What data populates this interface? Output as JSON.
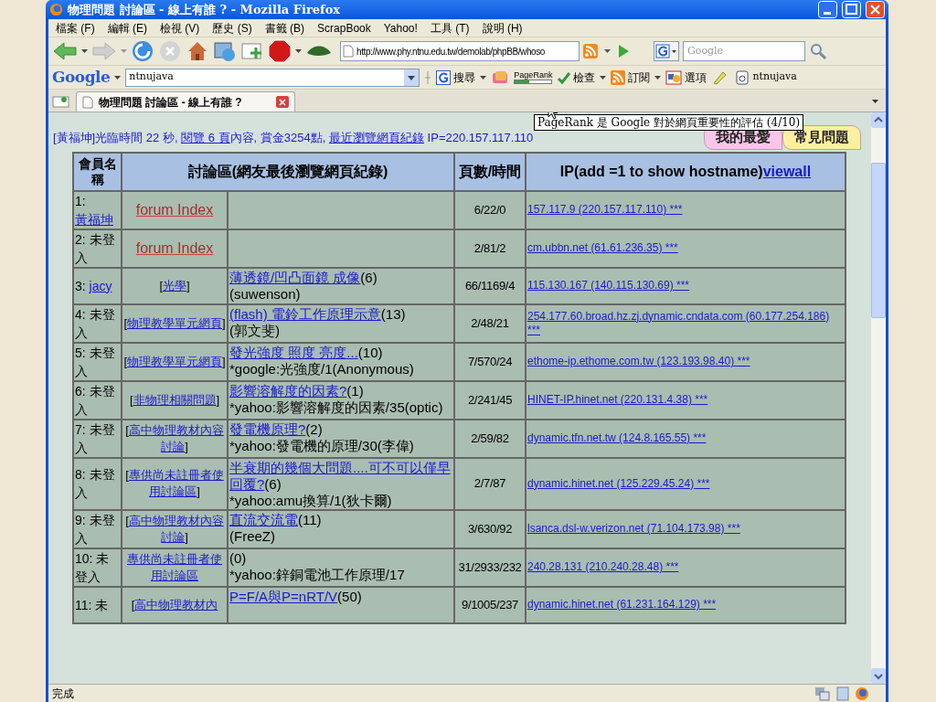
{
  "window": {
    "title": "物理問題 討論區 - 線上有誰 ? - Mozilla Firefox"
  },
  "menu": [
    "檔案 (F)",
    "編輯 (E)",
    "檢視 (V)",
    "歷史 (S)",
    "書籤 (B)",
    "ScrapBook",
    "Yahoo!",
    "工具 (T)",
    "說明 (H)"
  ],
  "navigation": {
    "url": "http://www.phy.ntnu.edu.tw/demolab/phpBB/whoso",
    "search_placeholder": "Google"
  },
  "google_toolbar": {
    "logo": "Google",
    "query": "ntnujava",
    "search": "搜尋",
    "pagerank": {
      "label": "PageRank",
      "level": 0.4
    },
    "check": "檢查",
    "subscribe": "訂閱",
    "options": "選項",
    "account": "ntnujava"
  },
  "tabs": [
    {
      "title": "物理問題 討論區 - 線上有誰 ?",
      "selected": true
    }
  ],
  "tooltip": "PageRank 是 Google 對於網頁重要性的評估 (4/10)",
  "info_line": [
    {
      "text": "[黃福坤]光臨時間 22 秒, ",
      "kind": "text"
    },
    {
      "text": "閱覽 6 頁",
      "kind": "link"
    },
    {
      "text": "內容, 賞金3254點, ",
      "kind": "text"
    },
    {
      "text": "最近瀏覽網頁紀錄",
      "kind": "link"
    },
    {
      "text": " IP=220.157.117.110",
      "kind": "text"
    }
  ],
  "page_tabs": [
    {
      "label": "我的最愛",
      "color": "#f9c6ea"
    },
    {
      "label": "常見問題",
      "color": "#fbf0a0"
    }
  ],
  "table": {
    "columns": [
      "會員名稱",
      "討論區(網友最後瀏覽網頁紀錄)",
      "頁數/時間",
      "IP(add =1 to show hostname)"
    ],
    "column_link": "viewall",
    "rows": [
      {
        "number": "1:",
        "name": "黃福坤",
        "registered": true,
        "forum": {
          "kind": "index",
          "label": "forum Index"
        },
        "pages": "6/22/0",
        "ip": "157.117.9 (220.157.117.110) ***"
      },
      {
        "number": "2:",
        "name": "未登入",
        "registered": false,
        "forum": {
          "kind": "index",
          "label": "forum Index"
        },
        "pages": "2/81/2",
        "ip": "cm.ubbn.net (61.61.236.35) ***"
      },
      {
        "number": "3:",
        "name": "jacy",
        "registered": true,
        "forum": {
          "kind": "category",
          "before": "[",
          "label": "光學",
          "after": "]"
        },
        "topic": {
          "title": "薄透鏡/凹凸面鏡 成像",
          "count": "(6)",
          "note": "(suwenson)"
        },
        "pages": "66/1169/4",
        "ip": "115.130.167 (140.115.130.69) ***"
      },
      {
        "number": "4:",
        "name": "未登入",
        "registered": false,
        "forum": {
          "kind": "category",
          "before": "[",
          "label": "物理教學單元網頁",
          "after": "]"
        },
        "topic": {
          "title": "(flash) 電鈴工作原理示意",
          "count": "(13)",
          "note": "(郭文斐)"
        },
        "pages": "2/48/21",
        "ip": "254.177.60.broad.hz.zj.dynamic.cndata.com (60.177.254.186) ***"
      },
      {
        "number": "5:",
        "name": "未登入",
        "registered": false,
        "forum": {
          "kind": "category",
          "before": "[",
          "label": "物理教學單元網頁",
          "after": "]"
        },
        "topic": {
          "title": "發光強度 照度 亮度...",
          "count": "(10)",
          "note": "*google:光強度/1(Anonymous)"
        },
        "pages": "7/570/24",
        "ip": "ethome-ip.ethome.com.tw (123.193.98.40) ***"
      },
      {
        "number": "6:",
        "name": "未登入",
        "registered": false,
        "forum": {
          "kind": "category",
          "before": "[",
          "label": "非物理相關問題",
          "after": "]"
        },
        "topic": {
          "title": "影響溶解度的因素?",
          "count": "(1)",
          "note": "*yahoo:影響溶解度的因素/35(optic)"
        },
        "pages": "2/241/45",
        "ip": "HINET-IP.hinet.net (220.131.4.38) ***"
      },
      {
        "number": "7:",
        "name": "未登入",
        "registered": false,
        "forum": {
          "kind": "category",
          "before": "[",
          "label": "高中物理教材內容討論",
          "after": "]"
        },
        "topic": {
          "title": "發電機原理?",
          "count": "(2)",
          "note": "*yahoo:發電機的原理/30(李偉)"
        },
        "pages": "2/59/82",
        "ip": "dynamic.tfn.net.tw (124.8.165.55) ***"
      },
      {
        "number": "8:",
        "name": "未登入",
        "registered": false,
        "forum": {
          "kind": "category",
          "before": "[",
          "label": "專供尚未註冊者使用討論區",
          "after": "]"
        },
        "topic": {
          "title": "半衰期的幾個大問題....可不可以僅早回覆?",
          "count": "(6)",
          "note": "*yahoo:amu換算/1(狄卡爾)"
        },
        "pages": "2/7/87",
        "ip": "dynamic.hinet.net (125.229.45.24) ***"
      },
      {
        "number": "9:",
        "name": "未登入",
        "registered": false,
        "forum": {
          "kind": "category",
          "before": "[",
          "label": "高中物理教材內容討論",
          "after": "]"
        },
        "topic": {
          "title": "直流交流電",
          "count": "(11)",
          "note": "(FreeZ)"
        },
        "pages": "3/630/92",
        "ip": "lsanca.dsl-w.verizon.net (71.104.173.98) ***"
      },
      {
        "number": "10:",
        "name": "未登入",
        "registered": false,
        "forum": {
          "kind": "category",
          "label": "專供尚未註冊者使用討論區"
        },
        "topic": {
          "count": "(0)",
          "note": "*yahoo:鋅銅電池工作原理/17"
        },
        "pages": "31/2933/232",
        "ip": "240.28.131 (210.240.28.48) ***"
      },
      {
        "number": "11:",
        "name": "未",
        "registered": false,
        "forum": {
          "kind": "category",
          "before": "[",
          "label": "高中物理教材內"
        },
        "topic": {
          "title": "P=F/A與P=nRT/V",
          "count": "(50)"
        },
        "pages": "9/1005/237",
        "ip": "dynamic.hinet.net (61.231.164.129) ***"
      }
    ]
  },
  "status_bar": "完成"
}
